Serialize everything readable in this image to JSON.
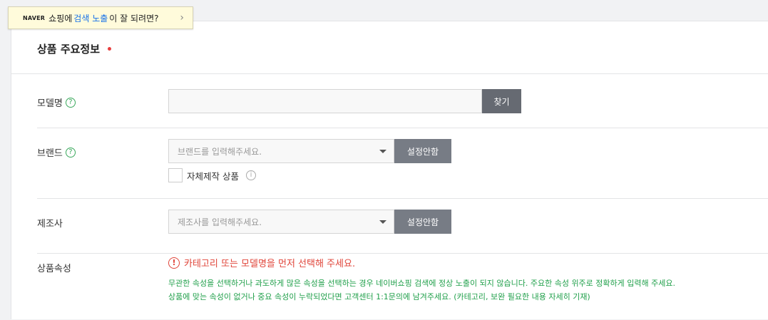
{
  "banner": {
    "naver": "NAVER",
    "text_before": "쇼핑에",
    "highlight": "검색 노출",
    "text_after": "이 잘 되려면?",
    "chevron": "›"
  },
  "section": {
    "title": "상품 주요정보"
  },
  "model": {
    "label": "모델명",
    "help": "?",
    "placeholder": "",
    "find_button": "찾기"
  },
  "brand": {
    "label": "브랜드",
    "help": "?",
    "placeholder": "브랜드를 입력해주세요.",
    "button": "설정안함",
    "own_label": "자체제작 상품",
    "info": "i"
  },
  "maker": {
    "label": "제조사",
    "placeholder": "제조사를 입력해주세요.",
    "button": "설정안함"
  },
  "attributes": {
    "label": "상품속성",
    "warn_icon": "!",
    "warning": "카테고리 또는 모델명을 먼저 선택해 주세요.",
    "guide_line1": "무관한 속성을 선택하거나 과도하게 많은 속성을 선택하는 경우 네이버쇼핑 검색에 정상 노출이 되지 않습니다. 주요한 속성 위주로 정확하게 입력해 주세요.",
    "guide_line2": "상품에 맞는 속성이 없거나 중요 속성이 누락되었다면 고객센터 1:1문의에 남겨주세요. (카테고리, 보완 필요한 내용 자세히 기재)"
  },
  "colors": {
    "required_dot": "#e83e3e",
    "warning": "#e0453a",
    "guide": "#21a04b",
    "help": "#3aa95c"
  }
}
